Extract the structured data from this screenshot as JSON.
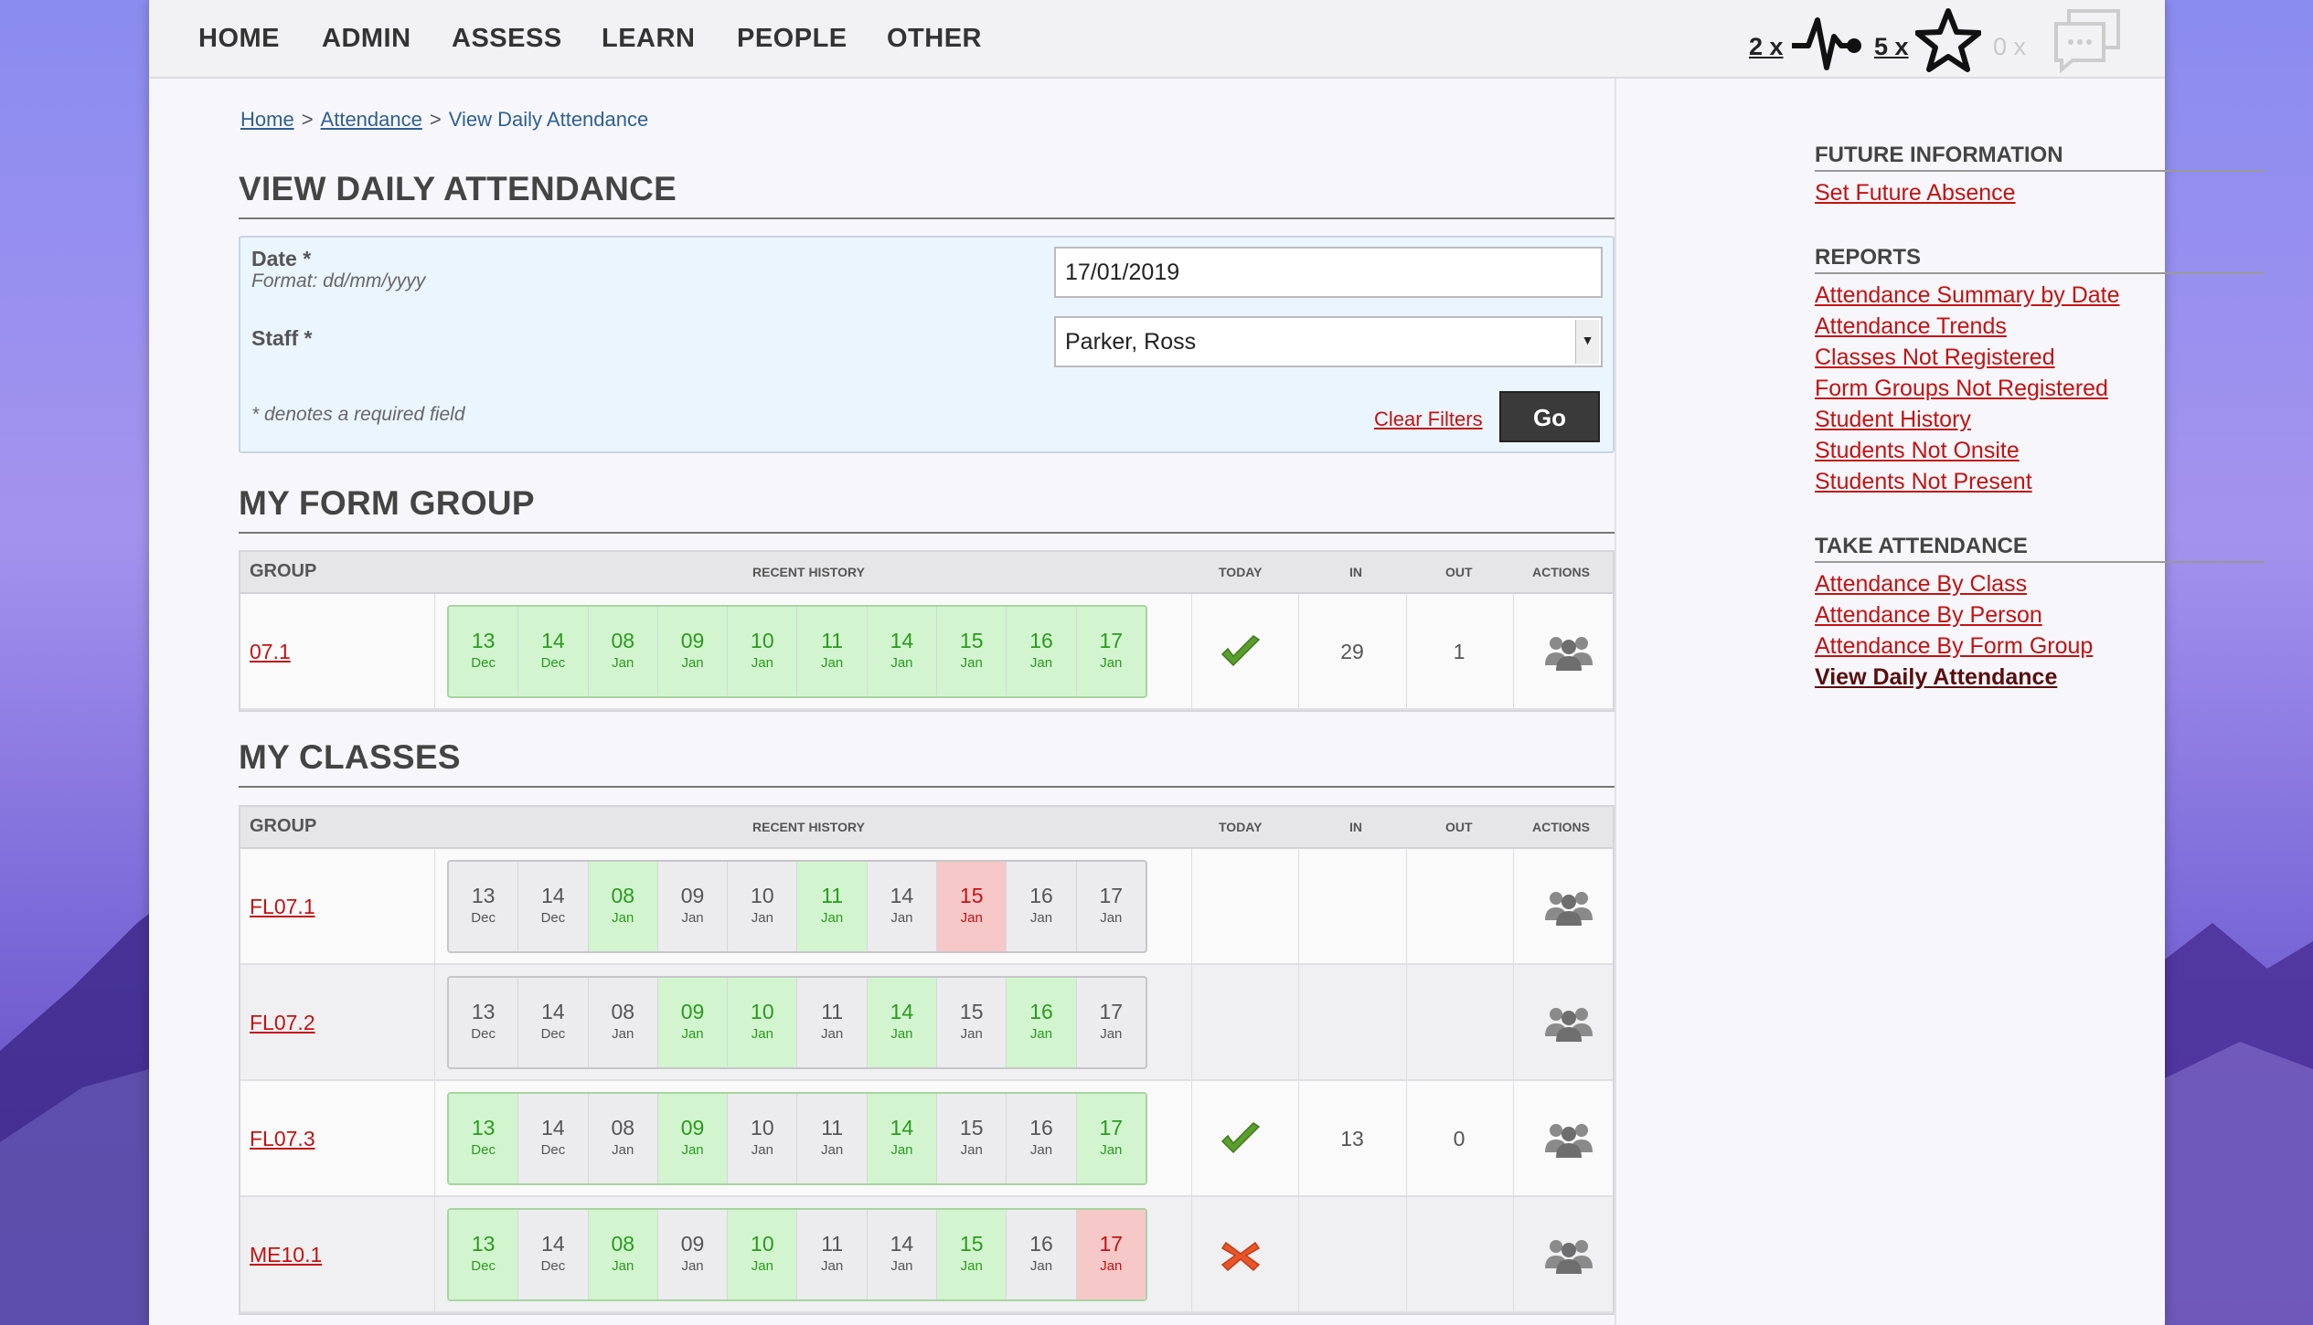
{
  "nav": {
    "items": [
      "HOME",
      "ADMIN",
      "ASSESS",
      "LEARN",
      "PEOPLE",
      "OTHER"
    ],
    "counters": {
      "pulse": "2 x",
      "star": "5 x",
      "chat": "0 x"
    }
  },
  "breadcrumb": {
    "home": "Home",
    "sep1": ">",
    "attendance": "Attendance",
    "sep2": ">",
    "current": "View Daily Attendance"
  },
  "page_title": "VIEW DAILY ATTENDANCE",
  "filter": {
    "date_label": "Date *",
    "date_hint": "Format: dd/mm/yyyy",
    "date_value": "17/01/2019",
    "staff_label": "Staff *",
    "staff_value": "Parker, Ross",
    "required_note": "* denotes a required field",
    "clear_label": "Clear Filters",
    "go_label": "Go"
  },
  "form_group_title": "MY FORM GROUP",
  "classes_title": "MY CLASSES",
  "table_headers": {
    "group": "GROUP",
    "history": "RECENT HISTORY",
    "today": "TODAY",
    "in": "IN",
    "out": "OUT",
    "actions": "ACTIONS"
  },
  "history_days": [
    {
      "d": "13",
      "m": "Dec"
    },
    {
      "d": "14",
      "m": "Dec"
    },
    {
      "d": "08",
      "m": "Jan"
    },
    {
      "d": "09",
      "m": "Jan"
    },
    {
      "d": "10",
      "m": "Jan"
    },
    {
      "d": "11",
      "m": "Jan"
    },
    {
      "d": "14",
      "m": "Jan"
    },
    {
      "d": "15",
      "m": "Jan"
    },
    {
      "d": "16",
      "m": "Jan"
    },
    {
      "d": "17",
      "m": "Jan"
    }
  ],
  "form_group_rows": [
    {
      "group": "07.1",
      "status": [
        "g",
        "g",
        "g",
        "g",
        "g",
        "g",
        "g",
        "g",
        "g",
        "g"
      ],
      "today": "check",
      "in": "29",
      "out": "1",
      "border": "green"
    }
  ],
  "class_rows": [
    {
      "group": "FL07.1",
      "status": [
        "n",
        "n",
        "g",
        "n",
        "n",
        "g",
        "n",
        "r",
        "n",
        "n"
      ],
      "today": "",
      "in": "",
      "out": "",
      "border": "grey"
    },
    {
      "group": "FL07.2",
      "status": [
        "n",
        "n",
        "n",
        "g",
        "g",
        "n",
        "g",
        "n",
        "g",
        "n"
      ],
      "today": "",
      "in": "",
      "out": "",
      "border": "grey"
    },
    {
      "group": "FL07.3",
      "status": [
        "g",
        "n",
        "n",
        "g",
        "n",
        "n",
        "g",
        "n",
        "n",
        "g"
      ],
      "today": "check",
      "in": "13",
      "out": "0",
      "border": "green"
    },
    {
      "group": "ME10.1",
      "status": [
        "g",
        "n",
        "g",
        "n",
        "g",
        "n",
        "n",
        "g",
        "n",
        "r"
      ],
      "today": "cross",
      "in": "",
      "out": "",
      "border": "green"
    }
  ],
  "sidebar": {
    "future": {
      "heading": "FUTURE INFORMATION",
      "links": [
        "Set Future Absence"
      ]
    },
    "reports": {
      "heading": "REPORTS",
      "links": [
        "Attendance Summary by Date",
        "Attendance Trends",
        "Classes Not Registered",
        "Form Groups Not Registered",
        "Student History",
        "Students Not Onsite",
        "Students Not Present"
      ]
    },
    "take": {
      "heading": "TAKE ATTENDANCE",
      "links": [
        "Attendance By Class",
        "Attendance By Person",
        "Attendance By Form Group",
        "View Daily Attendance"
      ],
      "active": "View Daily Attendance"
    }
  },
  "colors": {
    "link_red": "#c41212",
    "present_green": "#2b9a1e",
    "absent_red_bg": "#f7c8c8",
    "present_bg": "#d2f5d0"
  }
}
